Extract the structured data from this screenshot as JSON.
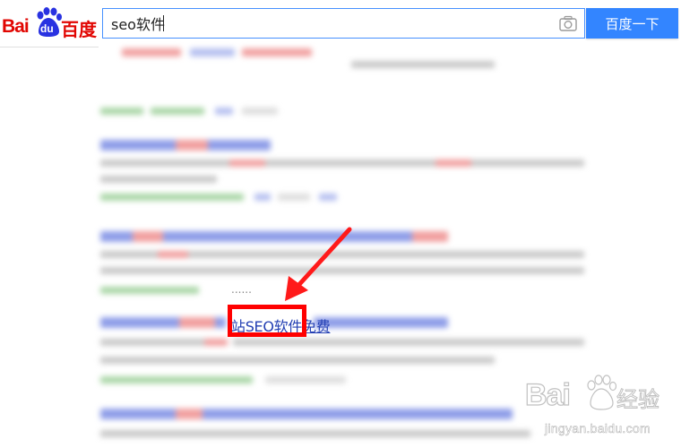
{
  "logo": {
    "text_bai": "Bai",
    "text_du": "du",
    "text_cn": "百度"
  },
  "search": {
    "value": "seo软件",
    "button_label": "百度一下"
  },
  "result_link": {
    "text": "站SEO软件免费",
    "dots": "......"
  },
  "watermark": {
    "text_bai": "Bai",
    "text_cn": "经验",
    "url": "jingyan.baidu.com"
  },
  "colors": {
    "brand_red": "#e10602",
    "button_blue": "#3385ff",
    "search_border": "#4791ff",
    "link_blue": "#2440b3",
    "annotation_red": "#ff0000"
  },
  "icons": {
    "camera": "camera-icon",
    "arrow": "annotation-arrow-icon",
    "paw": "paw-logo-icon"
  }
}
